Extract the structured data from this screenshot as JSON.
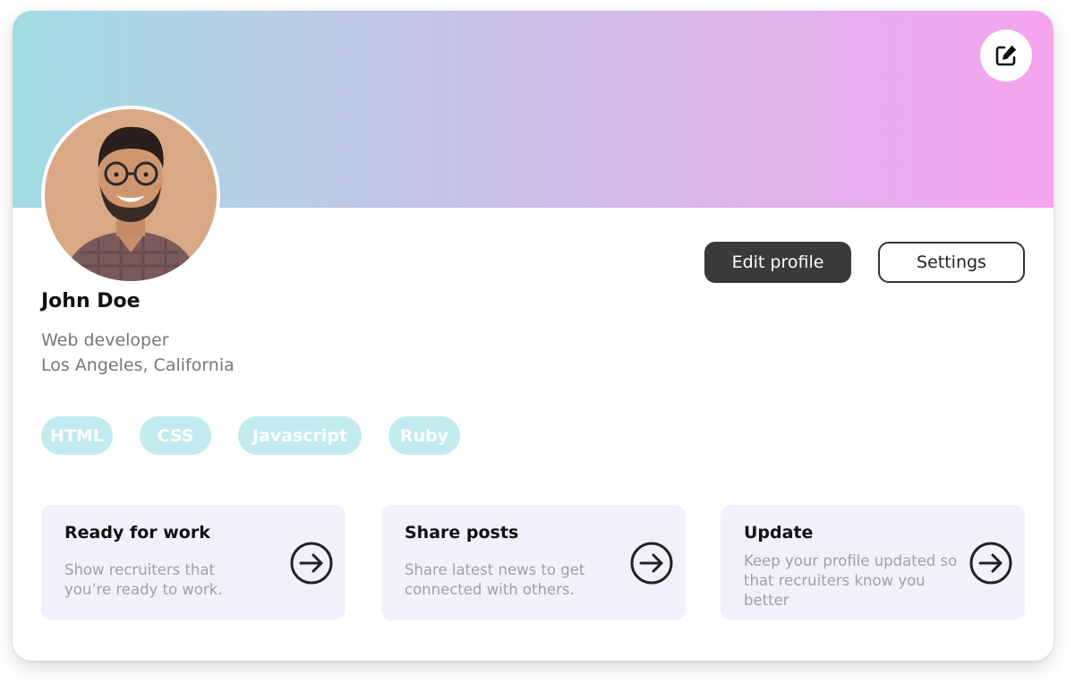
{
  "profile": {
    "name": "John Doe",
    "role": "Web developer",
    "location": "Los Angeles, California"
  },
  "actions": {
    "edit_profile": "Edit profile",
    "settings": "Settings"
  },
  "skills": [
    "HTML",
    "CSS",
    "Javascript",
    "Ruby"
  ],
  "cards": [
    {
      "title": "Ready for work",
      "description": "Show recruiters that you’re ready to work."
    },
    {
      "title": "Share posts",
      "description": "Share latest news to get connected with others."
    },
    {
      "title": "Update",
      "description": "Keep your profile updated so that recruiters know you better"
    }
  ],
  "icons": {
    "cover_edit": "edit-icon",
    "card_arrow": "arrow-right-circle-icon"
  },
  "colors": {
    "cover_gradient_start": "#a2dce3",
    "cover_gradient_end": "#f5a4ee",
    "primary_button": "#3a3a3a",
    "tag_background": "#c2ebf0",
    "card_background": "#f2f1fb"
  }
}
